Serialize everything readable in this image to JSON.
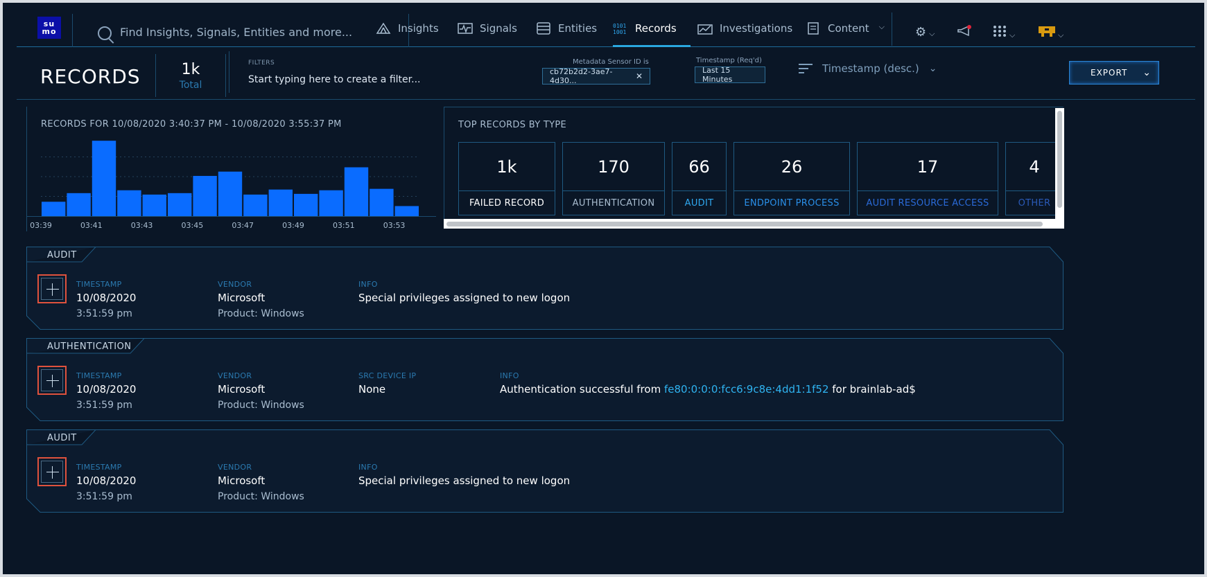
{
  "nav": {
    "logo_text": "su mo",
    "search_placeholder": "Find Insights, Signals, Entities and more...",
    "items": [
      {
        "label": "Insights",
        "icon": "insights-icon"
      },
      {
        "label": "Signals",
        "icon": "signals-icon"
      },
      {
        "label": "Entities",
        "icon": "entities-icon"
      },
      {
        "label": "Records",
        "icon": "records-icon",
        "active": true
      },
      {
        "label": "Investigations",
        "icon": "investigations-icon"
      },
      {
        "label": "Content",
        "icon": "content-icon"
      }
    ],
    "right_icons": [
      "gear-icon",
      "megaphone-icon",
      "apps-grid-icon",
      "user-avatar-icon"
    ]
  },
  "header": {
    "title": "RECORDS",
    "total_value": "1k",
    "total_label": "Total",
    "filters_label": "FILTERS",
    "filter_placeholder": "Start typing here to create a filter...",
    "filter_chips": [
      {
        "label": "Metadata Sensor ID is",
        "value": "cb72b2d2-3ae7-4d30..."
      },
      {
        "label": "Timestamp (Req'd)",
        "value": "Last 15 Minutes"
      }
    ],
    "sort_label": "Timestamp (desc.)",
    "export_label": "EXPORT"
  },
  "histogram": {
    "title": "RECORDS FOR 10/08/2020 3:40:37 PM - 10/08/2020 3:55:37 PM"
  },
  "chart_data": {
    "type": "bar",
    "title": "RECORDS FOR 10/08/2020 3:40:37 PM - 10/08/2020 3:55:37 PM",
    "tick_labels": [
      "03:39",
      "03:41",
      "03:43",
      "03:45",
      "03:47",
      "03:49",
      "03:51",
      "03:53"
    ],
    "values": [
      20,
      32,
      105,
      36,
      30,
      32,
      56,
      62,
      30,
      37,
      31,
      36,
      68,
      38,
      14
    ],
    "ylim": [
      0,
      110
    ],
    "grid": true,
    "color": "#0a6cff"
  },
  "top_records": {
    "title": "TOP RECORDS BY TYPE",
    "types": [
      {
        "count": "1k",
        "label": "FAILED RECORD",
        "color": "#ffffff"
      },
      {
        "count": "170",
        "label": "AUTHENTICATION",
        "color": "#a9bdd0"
      },
      {
        "count": "66",
        "label": "AUDIT",
        "color": "#2fa8f0"
      },
      {
        "count": "26",
        "label": "ENDPOINT PROCESS",
        "color": "#2a8fe8"
      },
      {
        "count": "17",
        "label": "AUDIT RESOURCE ACCESS",
        "color": "#2a6ad8"
      },
      {
        "count": "4",
        "label": "OTHER",
        "color": "#2a5ab8"
      }
    ]
  },
  "records": [
    {
      "type": "AUDIT",
      "timestamp_label": "TIMESTAMP",
      "date": "10/08/2020",
      "time": "3:51:59 pm",
      "vendor_label": "VENDOR",
      "vendor": "Microsoft",
      "product": "Product: Windows",
      "info_label": "INFO",
      "info": "Special privileges assigned to new logon"
    },
    {
      "type": "AUTHENTICATION",
      "timestamp_label": "TIMESTAMP",
      "date": "10/08/2020",
      "time": "3:51:59 pm",
      "vendor_label": "VENDOR",
      "vendor": "Microsoft",
      "product": "Product: Windows",
      "src_label": "SRC DEVICE IP",
      "src_value": "None",
      "info_label": "INFO",
      "info_prefix": "Authentication successful from",
      "info_ip": "fe80:0:0:0:fcc6:9c8e:4dd1:1f52",
      "info_suffix": "for brainlab-ad$"
    },
    {
      "type": "AUDIT",
      "timestamp_label": "TIMESTAMP",
      "date": "10/08/2020",
      "time": "3:51:59 pm",
      "vendor_label": "VENDOR",
      "vendor": "Microsoft",
      "product": "Product: Windows",
      "info_label": "INFO",
      "info": "Special privileges assigned to new logon"
    }
  ]
}
